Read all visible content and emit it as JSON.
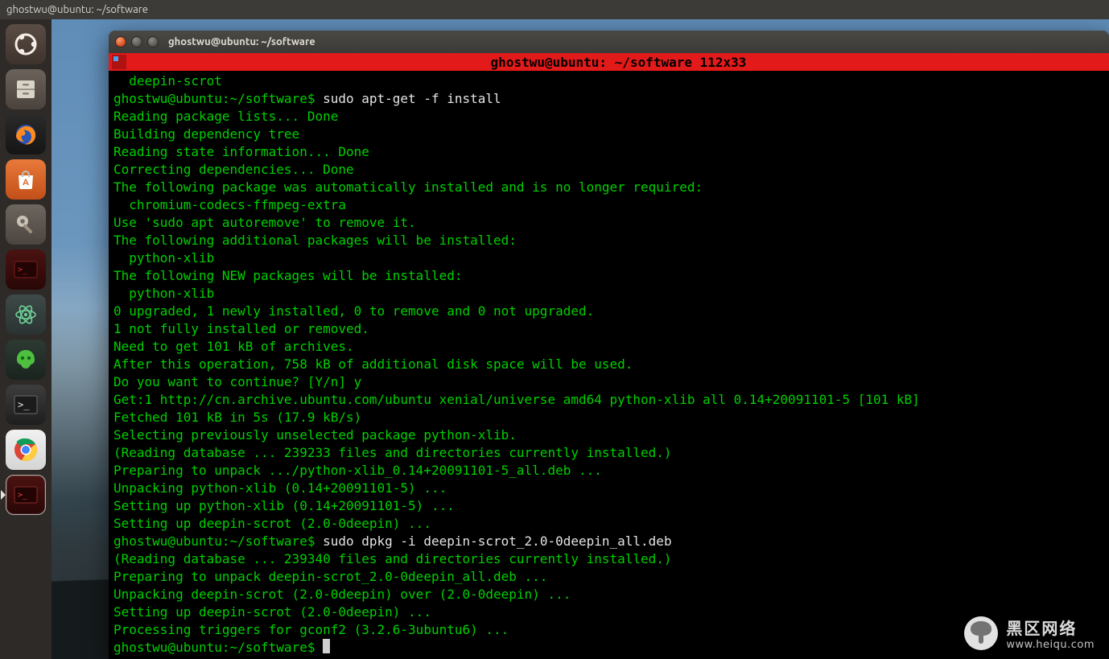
{
  "top_panel": {
    "title": "ghostwu@ubuntu: ~/software"
  },
  "launcher": {
    "items": [
      {
        "name": "dash-icon"
      },
      {
        "name": "files-icon"
      },
      {
        "name": "firefox-icon"
      },
      {
        "name": "software-center-icon"
      },
      {
        "name": "settings-icon"
      },
      {
        "name": "terminal-red-icon"
      },
      {
        "name": "atom-icon"
      },
      {
        "name": "navicat-icon"
      },
      {
        "name": "terminal-icon"
      },
      {
        "name": "chrome-icon"
      },
      {
        "name": "terminal-red2-icon"
      }
    ]
  },
  "terminal_window": {
    "title": "ghostwu@ubuntu: ~/software",
    "byobu_status": "ghostwu@ubuntu: ~/software 112x33",
    "lines": [
      "  deepin-scrot",
      "ghostwu@ubuntu:~/software$ sudo apt-get -f install",
      "Reading package lists... Done",
      "Building dependency tree       ",
      "Reading state information... Done",
      "Correcting dependencies... Done",
      "The following package was automatically installed and is no longer required:",
      "  chromium-codecs-ffmpeg-extra",
      "Use 'sudo apt autoremove' to remove it.",
      "The following additional packages will be installed:",
      "  python-xlib",
      "The following NEW packages will be installed:",
      "  python-xlib",
      "0 upgraded, 1 newly installed, 0 to remove and 0 not upgraded.",
      "1 not fully installed or removed.",
      "Need to get 101 kB of archives.",
      "After this operation, 758 kB of additional disk space will be used.",
      "Do you want to continue? [Y/n] y",
      "Get:1 http://cn.archive.ubuntu.com/ubuntu xenial/universe amd64 python-xlib all 0.14+20091101-5 [101 kB]",
      "Fetched 101 kB in 5s (17.9 kB/s)   ",
      "Selecting previously unselected package python-xlib.",
      "(Reading database ... 239233 files and directories currently installed.)",
      "Preparing to unpack .../python-xlib_0.14+20091101-5_all.deb ...",
      "Unpacking python-xlib (0.14+20091101-5) ...",
      "Setting up python-xlib (0.14+20091101-5) ...",
      "Setting up deepin-scrot (2.0-0deepin) ...",
      "ghostwu@ubuntu:~/software$ sudo dpkg -i deepin-scrot_2.0-0deepin_all.deb",
      "(Reading database ... 239340 files and directories currently installed.)",
      "Preparing to unpack deepin-scrot_2.0-0deepin_all.deb ...",
      "Unpacking deepin-scrot (2.0-0deepin) over (2.0-0deepin) ...",
      "Setting up deepin-scrot (2.0-0deepin) ...",
      "Processing triggers for gconf2 (3.2.6-3ubuntu6) ...",
      "ghostwu@ubuntu:~/software$ "
    ],
    "prompt_command_1": {
      "prompt": "ghostwu@ubuntu:~/software$ ",
      "cmd": "sudo apt-get -f install"
    },
    "prompt_command_2": {
      "prompt": "ghostwu@ubuntu:~/software$ ",
      "cmd": "sudo dpkg -i deepin-scrot_2.0-0deepin_all.deb"
    },
    "final_prompt": "ghostwu@ubuntu:~/software$ "
  },
  "watermark": {
    "line1": "黑区网络",
    "line2": "www.heiqu.com"
  }
}
